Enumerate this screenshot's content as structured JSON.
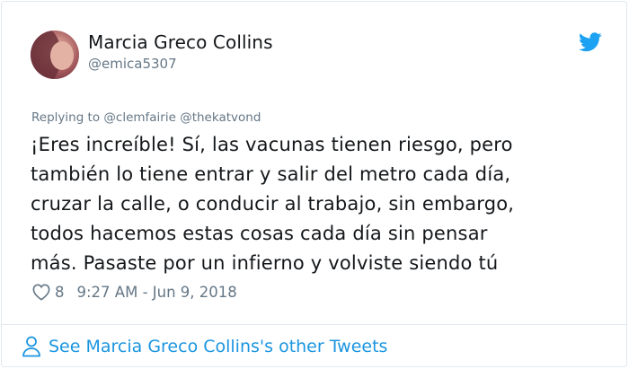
{
  "tweet": {
    "author_name": "Marcia Greco Collins",
    "author_handle": "@emica5307",
    "replying_lead": "Replying to",
    "replying_mentions": "@clemfairie @thekatvond",
    "text_lines": [
      "¡Eres increíble! Sí, las vacunas tienen riesgo, pero",
      "también lo tiene entrar y salir del metro cada día,",
      "cruzar la calle, o conducir al trabajo, sin embargo,",
      "todos hacemos estas cosas cada día sin pensar",
      "más. Pasaste por un infierno y volviste siendo tú"
    ],
    "like_count": "8",
    "timestamp": "9:27 AM - Jun 9, 2018"
  },
  "footer": {
    "link_text": "See Marcia Greco Collins's other Tweets"
  },
  "icons": {
    "brand": "twitter-bird-icon",
    "like": "heart-icon",
    "profile": "person-icon"
  },
  "colors": {
    "brand_blue": "#1da1f2",
    "link_blue": "#1b95e0",
    "muted_gray": "#657786",
    "text": "#14171a",
    "border": "#e1e8ed"
  }
}
